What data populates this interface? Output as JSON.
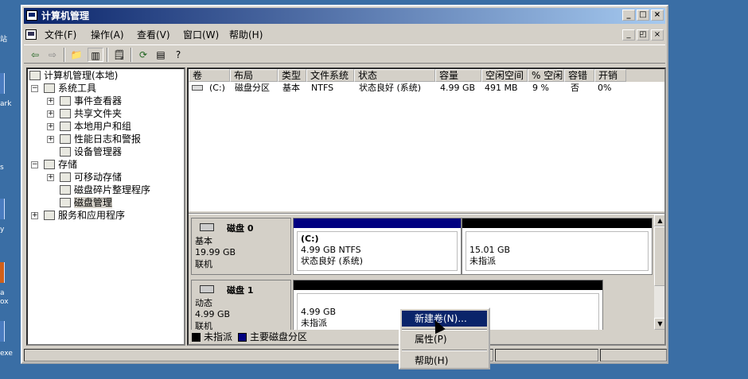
{
  "desktop": {
    "fragments": [
      "站",
      "ark",
      "s",
      "y",
      "a",
      "ox",
      "exe"
    ]
  },
  "window": {
    "title": "计算机管理",
    "controls": {
      "minimize": "_",
      "maximize": "□",
      "close": "×"
    }
  },
  "menu": {
    "items": [
      "文件(F)",
      "操作(A)",
      "查看(V)",
      "窗口(W)",
      "帮助(H)"
    ]
  },
  "toolbar": {
    "icons": [
      "back-icon",
      "forward-icon",
      "up-folder-icon",
      "show-hide-tree-icon",
      "properties-icon",
      "refresh-icon",
      "export-list-icon",
      "help-icon"
    ]
  },
  "tree": {
    "root": "计算机管理(本地)",
    "items": [
      {
        "label": "系统工具",
        "expander": "−"
      },
      {
        "label": "事件查看器",
        "expander": "+"
      },
      {
        "label": "共享文件夹",
        "expander": "+"
      },
      {
        "label": "本地用户和组",
        "expander": "+"
      },
      {
        "label": "性能日志和警报",
        "expander": "+"
      },
      {
        "label": "设备管理器",
        "expander": ""
      },
      {
        "label": "存储",
        "expander": "−"
      },
      {
        "label": "可移动存储",
        "expander": "+"
      },
      {
        "label": "磁盘碎片整理程序",
        "expander": ""
      },
      {
        "label": "磁盘管理",
        "expander": ""
      },
      {
        "label": "服务和应用程序",
        "expander": "+"
      }
    ]
  },
  "volumes": {
    "columns": [
      "卷",
      "布局",
      "类型",
      "文件系统",
      "状态",
      "容量",
      "空闲空间",
      "% 空闲",
      "容错",
      "开销"
    ],
    "rows": [
      [
        "(C:)",
        "磁盘分区",
        "基本",
        "NTFS",
        "状态良好 (系统)",
        "4.99 GB",
        "491 MB",
        "9 %",
        "否",
        "0%"
      ]
    ]
  },
  "disks": [
    {
      "name": "磁盘 0",
      "type": "基本",
      "size": "19.99 GB",
      "status": "联机",
      "partitions": [
        {
          "label": "(C:)",
          "size": "4.99 GB NTFS",
          "status": "状态良好 (系统)"
        },
        {
          "label": "",
          "size": "15.01 GB",
          "status": "未指派"
        }
      ]
    },
    {
      "name": "磁盘 1",
      "type": "动态",
      "size": "4.99 GB",
      "status": "联机",
      "partitions": [
        {
          "label": "",
          "size": "4.99 GB",
          "status": "未指派"
        }
      ]
    }
  ],
  "legend": [
    {
      "label": "未指派",
      "color": "#000000"
    },
    {
      "label": "主要磁盘分区",
      "color": "#000080"
    }
  ],
  "context_menu": {
    "items": [
      "新建卷(N)...",
      "属性(P)",
      "帮助(H)"
    ]
  },
  "colors": {
    "title_start": "#0a246a",
    "primary_partition": "#000080",
    "unallocated": "#000000",
    "face": "#d4d0c8",
    "desktop": "#3a6ea5"
  }
}
